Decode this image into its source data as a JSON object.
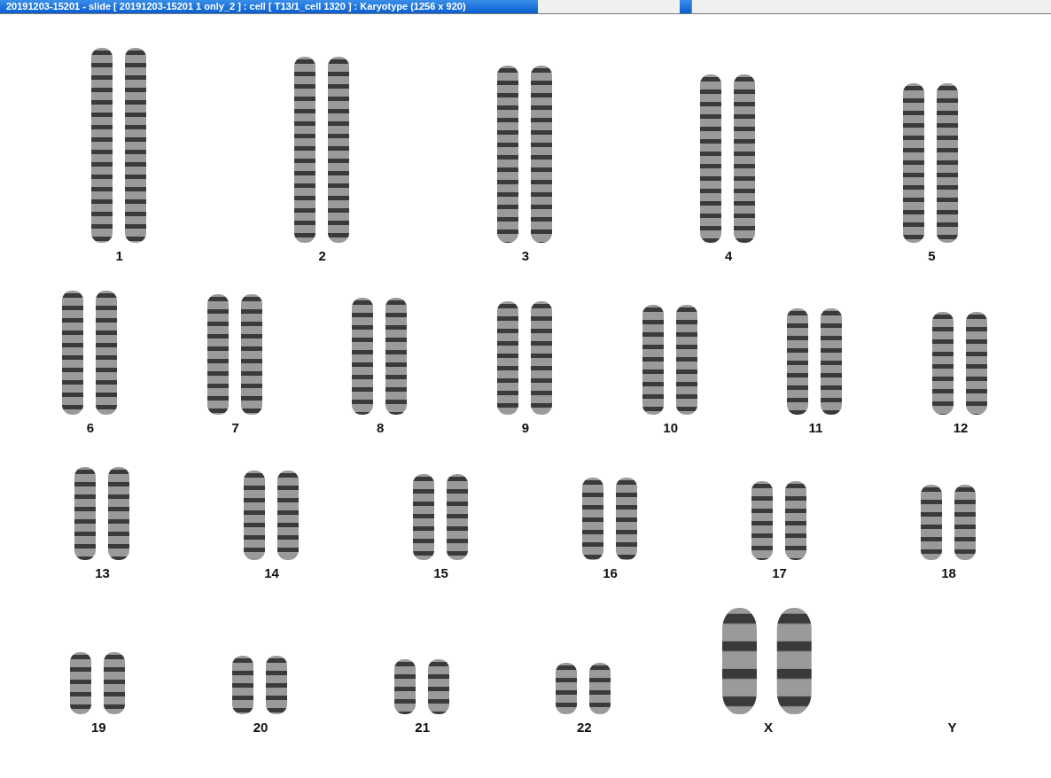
{
  "window": {
    "title": "20191203-15201 - slide [ 20191203-15201 1 only_2 ] : cell [ T13/1_cell 1320 ] : Karyotype  (1256 x 920)"
  },
  "karyotype": {
    "rows": [
      {
        "chromosomes": [
          {
            "label": "1",
            "kind": "pair"
          },
          {
            "label": "2",
            "kind": "pair"
          },
          {
            "label": "3",
            "kind": "pair"
          },
          {
            "label": "4",
            "kind": "pair"
          },
          {
            "label": "5",
            "kind": "pair"
          }
        ]
      },
      {
        "chromosomes": [
          {
            "label": "6",
            "kind": "pair"
          },
          {
            "label": "7",
            "kind": "pair"
          },
          {
            "label": "8",
            "kind": "pair"
          },
          {
            "label": "9",
            "kind": "pair"
          },
          {
            "label": "10",
            "kind": "pair"
          },
          {
            "label": "11",
            "kind": "pair"
          },
          {
            "label": "12",
            "kind": "pair"
          }
        ]
      },
      {
        "chromosomes": [
          {
            "label": "13",
            "kind": "pair"
          },
          {
            "label": "14",
            "kind": "pair"
          },
          {
            "label": "15",
            "kind": "pair"
          },
          {
            "label": "16",
            "kind": "pair"
          },
          {
            "label": "17",
            "kind": "pair"
          },
          {
            "label": "18",
            "kind": "pair"
          }
        ]
      },
      {
        "chromosomes": [
          {
            "label": "19",
            "kind": "pair"
          },
          {
            "label": "20",
            "kind": "pair"
          },
          {
            "label": "21",
            "kind": "pair"
          },
          {
            "label": "22",
            "kind": "pair"
          },
          {
            "label": "X",
            "kind": "pair"
          },
          {
            "label": "Y",
            "kind": "empty"
          }
        ]
      }
    ]
  }
}
